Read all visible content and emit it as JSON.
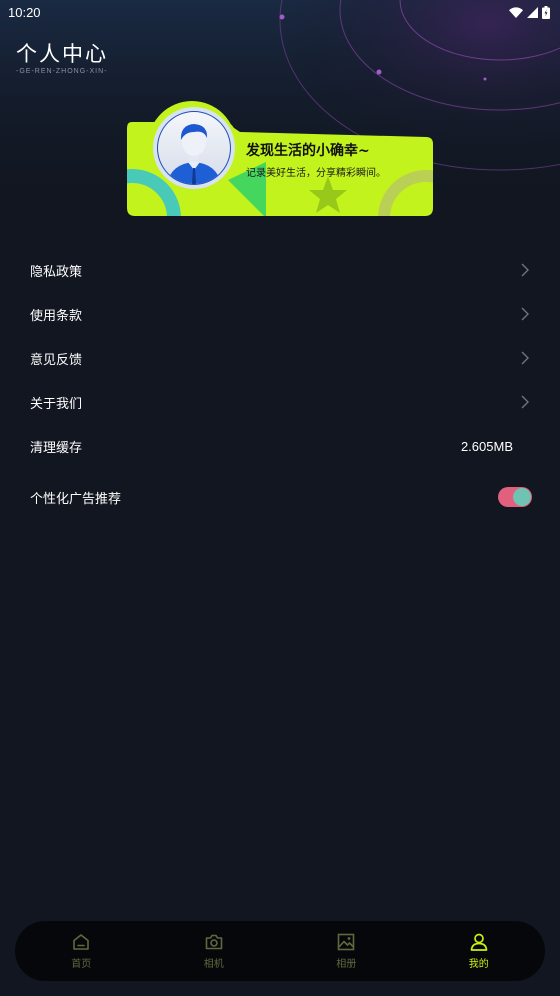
{
  "status_bar": {
    "time": "10:20"
  },
  "header": {
    "title": "个人中心",
    "subtitle": "-GE-REN-ZHONG-XIN-"
  },
  "profile_card": {
    "headline": "发现生活的小确幸~",
    "tagline": "记录美好生活，分享精彩瞬间。",
    "accent_color": "#c3f31c"
  },
  "menu": {
    "items": [
      {
        "label": "隐私政策"
      },
      {
        "label": "使用条款"
      },
      {
        "label": "意见反馈"
      },
      {
        "label": "关于我们"
      }
    ],
    "cache": {
      "label": "清理缓存",
      "value": "2.605MB"
    },
    "ads": {
      "label": "个性化广告推荐",
      "enabled": true
    }
  },
  "tabbar": {
    "tabs": [
      {
        "label": "首页",
        "icon": "home-icon"
      },
      {
        "label": "相机",
        "icon": "camera-icon"
      },
      {
        "label": "相册",
        "icon": "image-icon"
      },
      {
        "label": "我的",
        "icon": "user-icon"
      }
    ],
    "active_index": 3,
    "active_color": "#c8f20f",
    "inactive_color": "#5f6a3c"
  }
}
